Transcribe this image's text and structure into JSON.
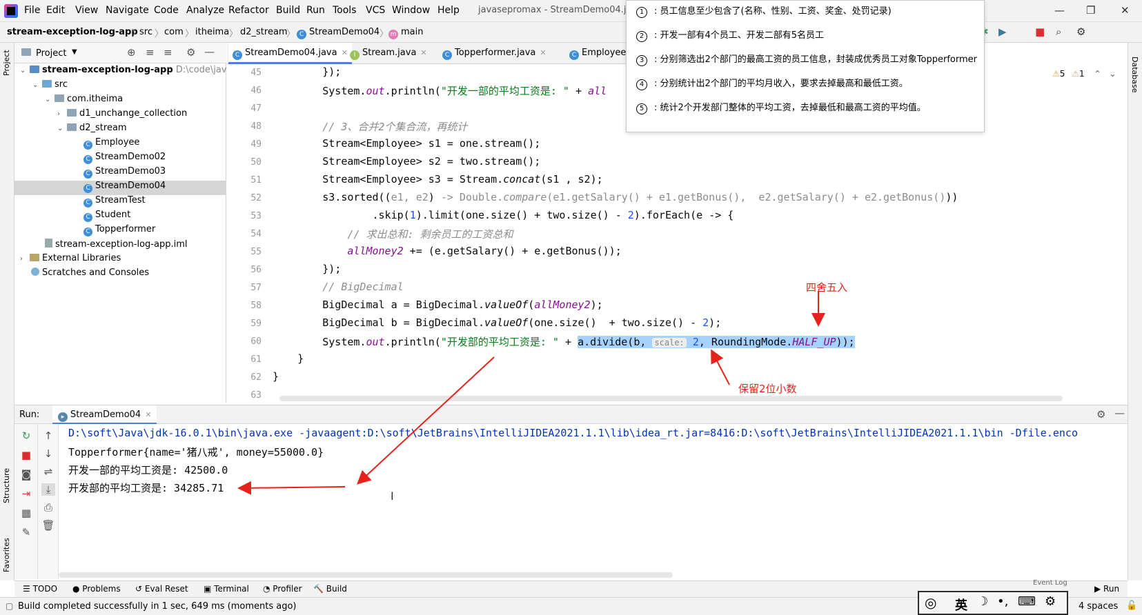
{
  "menubar": {
    "items": [
      "File",
      "Edit",
      "View",
      "Navigate",
      "Code",
      "Analyze",
      "Refactor",
      "Build",
      "Run",
      "Tools",
      "VCS",
      "Window",
      "Help"
    ],
    "window_title": "javasepromax - StreamDemo04.jav"
  },
  "breadcrumb": {
    "items": [
      "stream-exception-log-app",
      "src",
      "com",
      "itheima",
      "d2_stream",
      "StreamDemo04",
      "main"
    ]
  },
  "project_panel": {
    "title": "Project",
    "root": "stream-exception-log-app",
    "root_path": "D:\\code\\java",
    "nodes": [
      "src",
      "com.itheima",
      "d1_unchange_collection",
      "d2_stream",
      "Employee",
      "StreamDemo02",
      "StreamDemo03",
      "StreamDemo04",
      "StreamTest",
      "Student",
      "Topperformer",
      "stream-exception-log-app.iml",
      "External Libraries",
      "Scratches and Consoles"
    ]
  },
  "left_stripe": {
    "project": "Project",
    "structure": "Structure",
    "favorites": "Favorites"
  },
  "right_stripe": {
    "database": "Database"
  },
  "editor_tabs": [
    "StreamDemo04.java",
    "Stream.java",
    "Topperformer.java",
    "Employee.j"
  ],
  "editor": {
    "line_numbers": [
      "45",
      "46",
      "47",
      "48",
      "49",
      "50",
      "51",
      "52",
      "53",
      "54",
      "55",
      "56",
      "57",
      "58",
      "59",
      "60",
      "61",
      "62",
      "63"
    ],
    "lines": [
      "        });",
      "        System.out.println(\"开发一部的平均工资是: \" + all",
      "",
      "        // 3、合并2个集合流，再统计",
      "        Stream<Employee> s1 = one.stream();",
      "        Stream<Employee> s2 = two.stream();",
      "        Stream<Employee> s3 = Stream.concat(s1 , s2);",
      "        s3.sorted((e1, e2) -> Double.compare(e1.getSalary() + e1.getBonus(),  e2.getSalary() + e2.getBonus()))",
      "                .skip(1).limit(one.size() + two.size() - 2).forEach(e -> {",
      "            // 求出总和: 剩余员工的工资总和",
      "            allMoney2 += (e.getSalary() + e.getBonus());",
      "        });",
      "        // BigDecimal",
      "        BigDecimal a = BigDecimal.valueOf(allMoney2);",
      "        BigDecimal b = BigDecimal.valueOf(one.size()  + two.size() - 2);",
      "        System.out.println(\"开发部的平均工资是: \" + a.divide(b, scale: 2, RoundingMode.HALF_UP));",
      "    }",
      "}",
      ""
    ],
    "inlay_hint": "scale:",
    "warnings": {
      "warn_count": "5",
      "weak_count": "1"
    }
  },
  "tooltip": {
    "items": [
      {
        "num": "1",
        "text": "员工信息至少包含了(名称、性别、工资、奖金、处罚记录)"
      },
      {
        "num": "2",
        "text": "开发一部有4个员工、开发二部有5名员工"
      },
      {
        "num": "3",
        "text": "分别筛选出2个部门的最高工资的员工信息，封装成优秀员工对象Topperformer"
      },
      {
        "num": "4",
        "text": "分别统计出2个部门的平均月收入，要求去掉最高和最低工资。"
      },
      {
        "num": "5",
        "text": "统计2个开发部门整体的平均工资，去掉最低和最高工资的平均值。"
      }
    ]
  },
  "annotations": {
    "rounding": "四舍五入",
    "two_decimals": "保留2位小数"
  },
  "run_panel": {
    "label": "Run:",
    "tab": "StreamDemo04",
    "console": [
      "D:\\soft\\Java\\jdk-16.0.1\\bin\\java.exe -javaagent:D:\\soft\\JetBrains\\IntelliJIDEA2021.1.1\\lib\\idea_rt.jar=8416:D:\\soft\\JetBrains\\IntelliJIDEA2021.1.1\\bin -Dfile.enco",
      "Topperformer{name='猪八戒', money=55000.0}",
      "开发一部的平均工资是: 42500.0",
      "开发部的平均工资是: 34285.71"
    ]
  },
  "bottom_tabs": [
    "TODO",
    "Problems",
    "Eval Reset",
    "Terminal",
    "Profiler",
    "Build",
    "Event Log",
    "Run"
  ],
  "status": {
    "message": "Build completed successfully in 1 sec, 649 ms (moments ago)",
    "indent": "4 spaces"
  },
  "ime": {
    "lang": "英"
  }
}
